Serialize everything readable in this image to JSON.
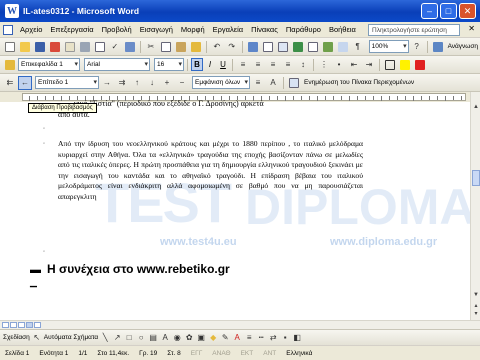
{
  "window": {
    "title": "IL-ates0312 - Microsoft Word",
    "app_icon_letter": "W"
  },
  "menu": {
    "items": [
      "Αρχείο",
      "Επεξεργασία",
      "Προβολή",
      "Εισαγωγή",
      "Μορφή",
      "Εργαλεία",
      "Πίνακας",
      "Παράθυρο",
      "Βοήθεια"
    ],
    "help_placeholder": "Πληκτρολογήστε ερώτηση"
  },
  "toolbar_standard": {
    "zoom": "100%",
    "read_label": "Ανάγνωση"
  },
  "toolbar_formatting": {
    "style": "Επικεφαλίδα 1",
    "font": "Arial",
    "size": "16",
    "bold": "B",
    "italic": "I",
    "underline": "U"
  },
  "toolbar_outline": {
    "level": "Επίπεδο 1",
    "show_level": "Εμφάνιση όλων",
    "update_toc": "Ενημέρωση του Πίνακα Περιεχομένων"
  },
  "tooltip": "Διάβαση Προβιβασμός",
  "document": {
    "para_top_line1": "νικό \"Εστία\" (περιοδικό που εξέδιδε ο Γ. Δροσίνης) αρκετά",
    "para_top_line2": "από αυτά.",
    "para_main": "Από την ίδρυση του νεοελληνικού κράτους και μέχρι το 1880 περίπου , το ιταλικό μελόδραμα κυριαρχεί στην Αθήνα. Όλα τα «ελληνικά» τραγούδια της εποχής βασίζονταν πάνω σε μελωδίες από τις ιταλικές όπερες. Η πρώτη προσπάθεια για τη δημιουργία ελληνικού τραγουδιού ξεκινάει με την εισαγωγή του καντάδα και το αθηναϊκό τραγούδι. Η επίδραση βέβαια του ιταλικού μελοδράματος είναι ενδιάκριτη αλλά αφομοιωμένη σε βαθμό που να μη παρουσιάζεται απαρεγκλιτη",
    "heading": "Η συνέχεια στο   www.rebetiko.gr"
  },
  "watermark": {
    "big_left": "TEST",
    "big_right": "DIPLOMA",
    "url_left": "www.test4u.eu",
    "url_right": "www.diploma.edu.gr"
  },
  "drawing": {
    "draw_label": "Σχεδίαση",
    "shapes_label": "Αυτόματα Σχήματα"
  },
  "status": {
    "page": "Σελίδα 1",
    "section": "Ενότητα 1",
    "pages": "1/1",
    "at": "Στο 11,4εκ.",
    "line": "Γρ. 19",
    "col": "Στ. 8",
    "modes": [
      "ΕΓΓ",
      "ΑΝΑΘ",
      "ΕΚΤ",
      "ΑΝΤ"
    ],
    "language": "Ελληνικά"
  }
}
